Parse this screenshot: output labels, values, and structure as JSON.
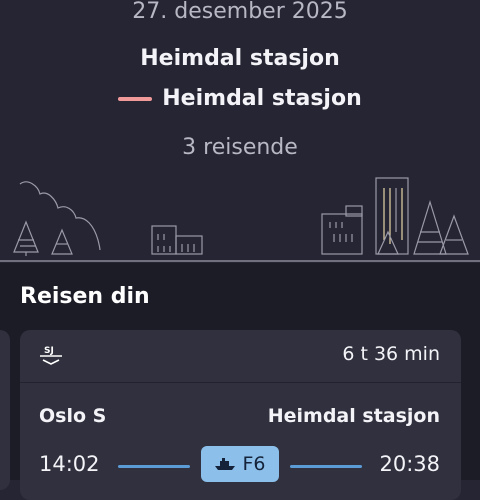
{
  "journey": {
    "date": "27. desember 2025",
    "from": "Heimdal stasjon",
    "to": "Heimdal stasjon",
    "travellers": "3 reisende"
  },
  "section": {
    "title": "Reisen din"
  },
  "trip": {
    "operator_icon": "sj-logo-icon",
    "duration": "6 t 36 min",
    "origin": "Oslo S",
    "destination": "Heimdal stasjon",
    "departure": "14:02",
    "arrival": "20:38",
    "line_label": "F6",
    "line_icon": "ferry-icon"
  },
  "colors": {
    "background_top": "#252534",
    "background_main": "#1c1c27",
    "card": "#30303e",
    "route_dash": "#f09a9a",
    "route_line": "#5b9bd6",
    "badge": "#8cbfea"
  }
}
